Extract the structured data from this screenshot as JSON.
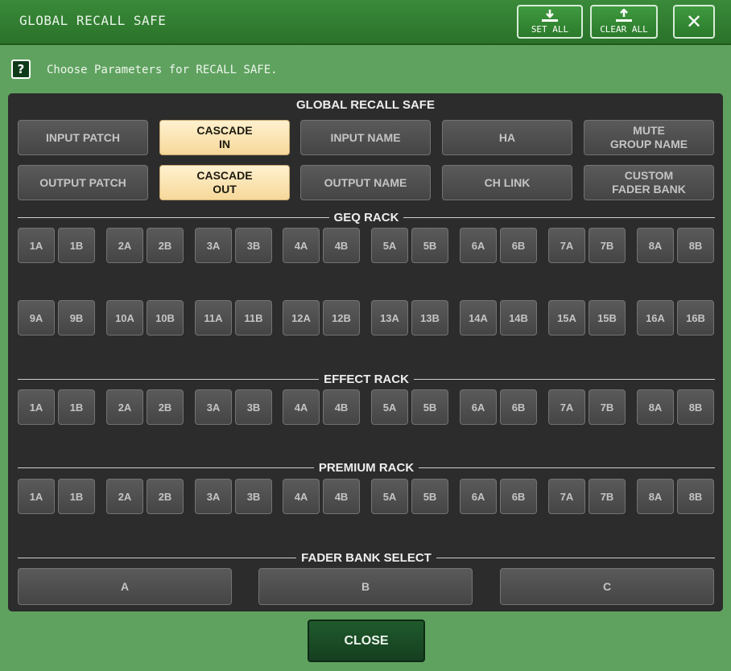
{
  "window": {
    "title": "GLOBAL RECALL SAFE"
  },
  "toolbar": {
    "set_all_label": "SET ALL",
    "clear_all_label": "CLEAR ALL",
    "close_icon": "close-icon"
  },
  "help": {
    "icon": "?",
    "text": "Choose Parameters for RECALL SAFE."
  },
  "panel": {
    "title": "GLOBAL RECALL SAFE",
    "main_buttons": [
      {
        "label": "INPUT PATCH",
        "on": false
      },
      {
        "label": "CASCADE\nIN",
        "on": true
      },
      {
        "label": "INPUT NAME",
        "on": false
      },
      {
        "label": "HA",
        "on": false
      },
      {
        "label": "MUTE\nGROUP NAME",
        "on": false
      },
      {
        "label": "OUTPUT PATCH",
        "on": false
      },
      {
        "label": "CASCADE\nOUT",
        "on": true
      },
      {
        "label": "OUTPUT NAME",
        "on": false
      },
      {
        "label": "CH LINK",
        "on": false
      },
      {
        "label": "CUSTOM\nFADER BANK",
        "on": false
      }
    ]
  },
  "geq_rack": {
    "label": "GEQ RACK",
    "row1": [
      "1A",
      "1B",
      "2A",
      "2B",
      "3A",
      "3B",
      "4A",
      "4B",
      "5A",
      "5B",
      "6A",
      "6B",
      "7A",
      "7B",
      "8A",
      "8B"
    ],
    "row2": [
      "9A",
      "9B",
      "10A",
      "10B",
      "11A",
      "11B",
      "12A",
      "12B",
      "13A",
      "13B",
      "14A",
      "14B",
      "15A",
      "15B",
      "16A",
      "16B"
    ]
  },
  "effect_rack": {
    "label": "EFFECT RACK",
    "row1": [
      "1A",
      "1B",
      "2A",
      "2B",
      "3A",
      "3B",
      "4A",
      "4B",
      "5A",
      "5B",
      "6A",
      "6B",
      "7A",
      "7B",
      "8A",
      "8B"
    ]
  },
  "premium_rack": {
    "label": "PREMIUM RACK",
    "row1": [
      "1A",
      "1B",
      "2A",
      "2B",
      "3A",
      "3B",
      "4A",
      "4B",
      "5A",
      "5B",
      "6A",
      "6B",
      "7A",
      "7B",
      "8A",
      "8B"
    ]
  },
  "fader_bank": {
    "label": "FADER BANK SELECT",
    "buttons": [
      "A",
      "B",
      "C"
    ]
  },
  "footer": {
    "close_label": "CLOSE"
  }
}
